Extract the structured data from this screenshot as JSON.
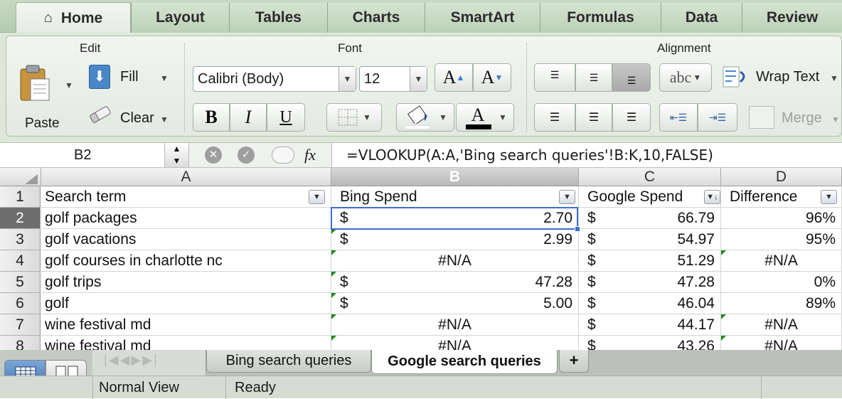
{
  "tabs": [
    "Home",
    "Layout",
    "Tables",
    "Charts",
    "SmartArt",
    "Formulas",
    "Data",
    "Review"
  ],
  "ribbon": {
    "groups": {
      "edit": "Edit",
      "font": "Font",
      "alignment": "Alignment"
    },
    "paste": "Paste",
    "fill": "Fill",
    "clear": "Clear",
    "font_name": "Calibri (Body)",
    "font_size": "12",
    "bold": "B",
    "italic": "I",
    "underline": "U",
    "grow_font": "A",
    "shrink_font": "A",
    "font_color_glyph": "A",
    "orientation": "abc",
    "wrap_text": "Wrap Text",
    "merge": "Merge"
  },
  "formula_bar": {
    "cell_ref": "B2",
    "fx": "fx",
    "formula": "=VLOOKUP(A:A,'Bing search queries'!B:K,10,FALSE)"
  },
  "columns": {
    "A": "A",
    "B": "B",
    "C": "C",
    "D": "D"
  },
  "headers": {
    "a": "Search term",
    "b": "Bing Spend",
    "c": "Google Spend",
    "d": "Difference"
  },
  "rows": [
    {
      "n": "2",
      "term": "golf packages",
      "bing_cur": "$",
      "bing": "2.70",
      "google": "66.79",
      "diff": "96%"
    },
    {
      "n": "3",
      "term": "golf vacations",
      "bing_cur": "$",
      "bing": "2.99",
      "google": "54.97",
      "diff": "95%"
    },
    {
      "n": "4",
      "term": "golf courses in charlotte nc",
      "bing_cur": "",
      "bing": "#N/A",
      "google": "51.29",
      "diff": "#N/A"
    },
    {
      "n": "5",
      "term": "golf trips",
      "bing_cur": "$",
      "bing": "47.28",
      "google": "47.28",
      "diff": "0%"
    },
    {
      "n": "6",
      "term": "golf",
      "bing_cur": "$",
      "bing": "5.00",
      "google": "46.04",
      "diff": "89%"
    },
    {
      "n": "7",
      "term": "wine festival md",
      "bing_cur": "",
      "bing": "#N/A",
      "google": "44.17",
      "diff": "#N/A"
    },
    {
      "n": "8",
      "term": "wine festival md",
      "bing_cur": "",
      "bing": "#N/A",
      "google": "43.26",
      "diff": "#N/A"
    }
  ],
  "row1_label": "1",
  "currency": "$",
  "sheets": [
    "Bing search queries",
    "Google search queries"
  ],
  "add_sheet": "+",
  "status": {
    "view": "Normal View",
    "state": "Ready"
  },
  "colors": {
    "ribbon_bg": "#dde8da",
    "selection": "#3a6fd1",
    "error_marker": "#1f8a1f"
  }
}
